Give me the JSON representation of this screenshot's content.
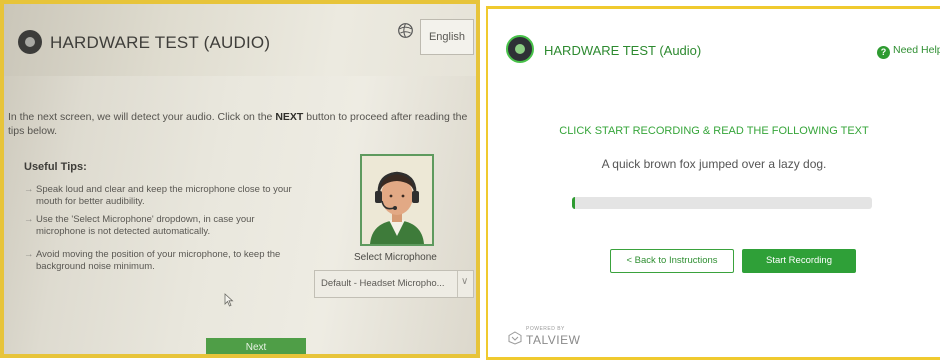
{
  "left_screen": {
    "title": "HARDWARE TEST (AUDIO)",
    "language": "English",
    "intro_before": "In the next screen, we will detect your audio. Click on the ",
    "intro_bold": "NEXT",
    "intro_after": " button to proceed after reading the tips below.",
    "tips_heading": "Useful Tips:",
    "tips": [
      "Speak loud and clear and keep the microphone close to your mouth for better audibility.",
      "Use the 'Select Microphone' dropdown, in case your microphone is not detected automatically.",
      "Avoid moving the position of your microphone, to keep the background noise minimum."
    ],
    "tip_arrow": "→",
    "select_label": "Select Microphone",
    "select_value": "Default - Headset Micropho...",
    "chevron": "∨",
    "next_label": "Next",
    "icons": [
      "app-logo-icon",
      "globe-icon",
      "headset-avatar",
      "mouse-cursor-icon"
    ],
    "colors": {
      "accent": "#4f9e47",
      "frame": "#e7c43a"
    }
  },
  "right_screen": {
    "title": "HARDWARE TEST (Audio)",
    "help_label": "Need Help?",
    "help_icon_glyph": "?",
    "instruction": "CLICK START RECORDING & READ THE FOLLOWING TEXT",
    "sentence": "A quick brown fox jumped over a lazy dog.",
    "progress_fraction": 0.01,
    "back_label": "< Back to Instructions",
    "record_label": "Start Recording",
    "powered_by": "POWERED BY",
    "brand": "TALVIEW",
    "icons": [
      "app-logo-icon",
      "help-icon",
      "talview-logo-icon"
    ],
    "colors": {
      "accent": "#2fa038",
      "text_green": "#36a53a",
      "frame": "#f0ca2f"
    }
  }
}
